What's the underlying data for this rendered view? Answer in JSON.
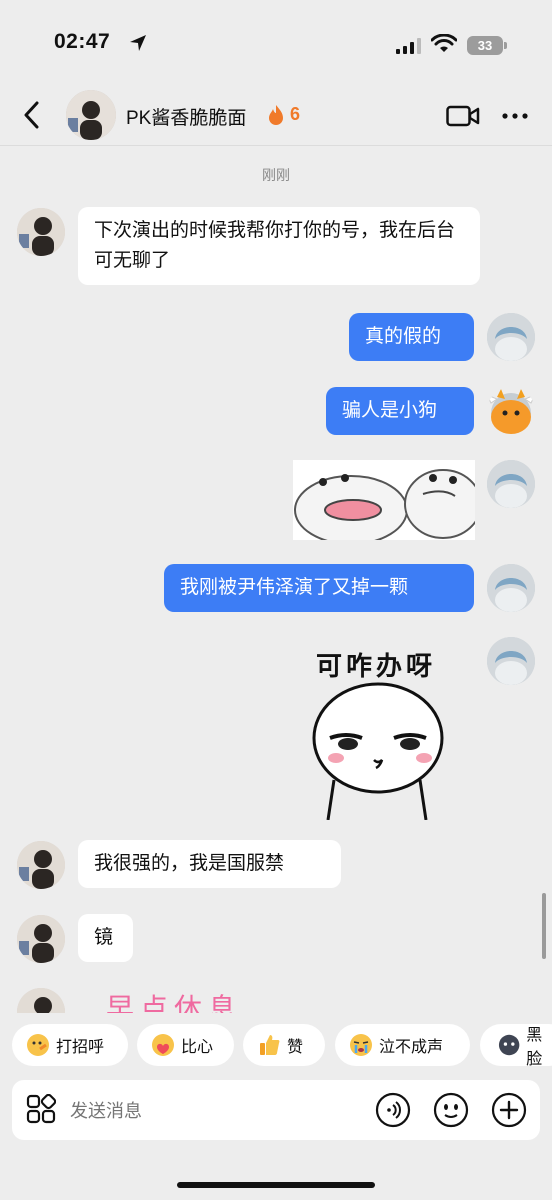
{
  "status": {
    "time": "02:47",
    "battery": "33"
  },
  "header": {
    "name": "PK酱香脆脆面",
    "streak": "6"
  },
  "timestamp": "刚刚",
  "messages": {
    "m1": "下次演出的时候我帮你打你的号，我在后台可无聊了",
    "m2": "真的假的",
    "m3": "骗人是小狗",
    "m4": "我刚被尹伟泽演了又掉一颗",
    "sticker2_text": "可咋办呀",
    "m5": "我很强的，我是国服禁",
    "m6": "镜",
    "m7_partial": "早点休息"
  },
  "quick_replies": [
    {
      "label": "打招呼",
      "icon": "wave-emoji-icon"
    },
    {
      "label": "比心",
      "icon": "heart-hands-emoji-icon"
    },
    {
      "label": "赞",
      "icon": "thumbs-up-icon"
    },
    {
      "label": "泣不成声",
      "icon": "crying-emoji-icon"
    },
    {
      "label": "黑脸",
      "icon": "dark-face-emoji-icon"
    }
  ],
  "input": {
    "placeholder": "发送消息"
  },
  "colors": {
    "outgoing": "#3d7df5",
    "incoming": "#ffffff",
    "background": "#ededed",
    "streak": "#f07a2a"
  }
}
